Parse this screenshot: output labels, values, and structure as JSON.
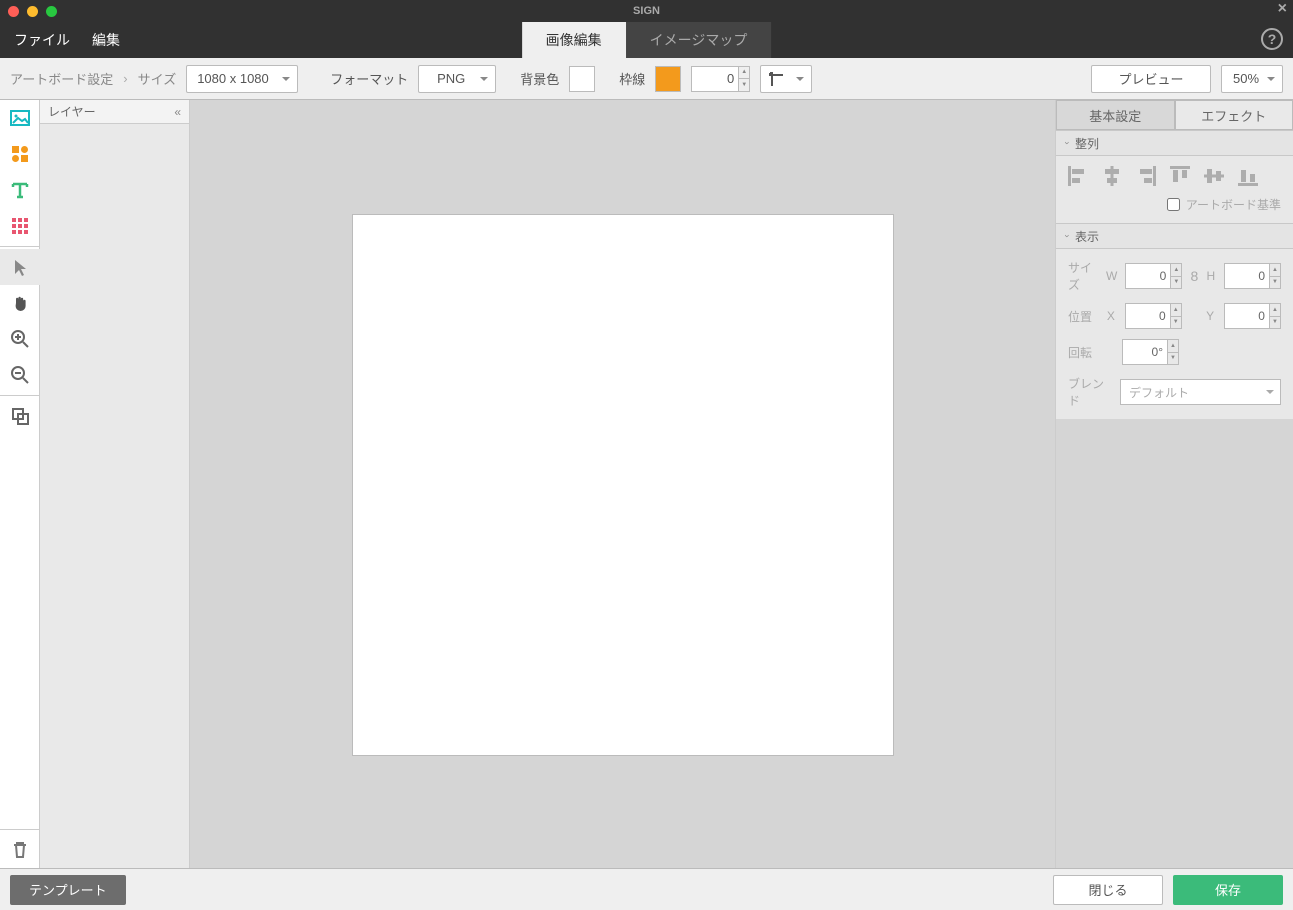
{
  "title": "SIGN",
  "menu": {
    "file": "ファイル",
    "edit": "編集"
  },
  "main_tabs": {
    "image_edit": "画像編集",
    "image_map": "イメージマップ"
  },
  "toolbar": {
    "artboard_settings": "アートボード設定",
    "size_label": "サイズ",
    "size_value": "1080 x 1080",
    "format_label": "フォーマット",
    "format_value": "PNG",
    "bg_label": "背景色",
    "bg_color": "#ffffff",
    "border_label": "枠線",
    "border_color": "#f39a1c",
    "border_width": "0",
    "preview": "プレビュー",
    "zoom": "50%"
  },
  "layers": {
    "header": "レイヤー"
  },
  "right": {
    "tabs": {
      "basic": "基本設定",
      "effect": "エフェクト"
    },
    "align": {
      "header": "整列",
      "artboard_base": "アートボード基準"
    },
    "display": {
      "header": "表示",
      "size": "サイズ",
      "w": "W",
      "h": "H",
      "w_val": "0",
      "h_val": "0",
      "pos": "位置",
      "x": "X",
      "y": "Y",
      "x_val": "0",
      "y_val": "0",
      "rotate": "回転",
      "rotate_val": "0°",
      "blend": "ブレンド",
      "blend_val": "デフォルト"
    }
  },
  "footer": {
    "template": "テンプレート",
    "close": "閉じる",
    "save": "保存"
  }
}
